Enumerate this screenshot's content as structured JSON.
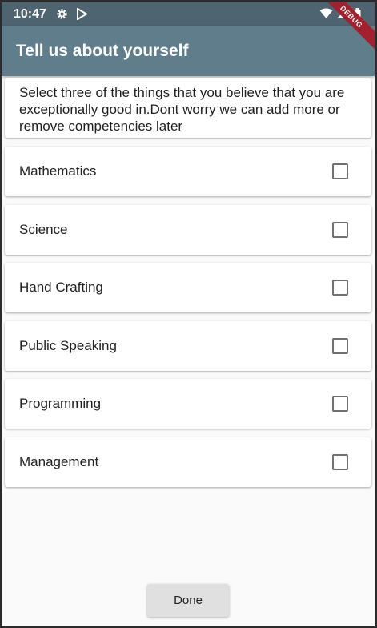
{
  "status_bar": {
    "time": "10:47",
    "icons": [
      "gear-icon",
      "play-store-icon",
      "wifi-icon",
      "signal-icon",
      "battery-icon"
    ]
  },
  "app_bar": {
    "title": "Tell us about yourself",
    "debug_label": "DEBUG"
  },
  "intro": {
    "text": "Select three of the things that you believe that you are exceptionally good in.Dont worry we can add more or remove competencies later"
  },
  "competencies": [
    {
      "label": "Mathematics",
      "checked": false
    },
    {
      "label": "Science",
      "checked": false
    },
    {
      "label": "Hand Crafting",
      "checked": false
    },
    {
      "label": "Public Speaking",
      "checked": false
    },
    {
      "label": "Programming",
      "checked": false
    },
    {
      "label": "Management",
      "checked": false
    }
  ],
  "done_button": {
    "label": "Done"
  },
  "colors": {
    "app_bar": "#607d8b",
    "status_bar": "#4e6470",
    "background": "#fafafa",
    "debug_ribbon": "#a5202e"
  }
}
